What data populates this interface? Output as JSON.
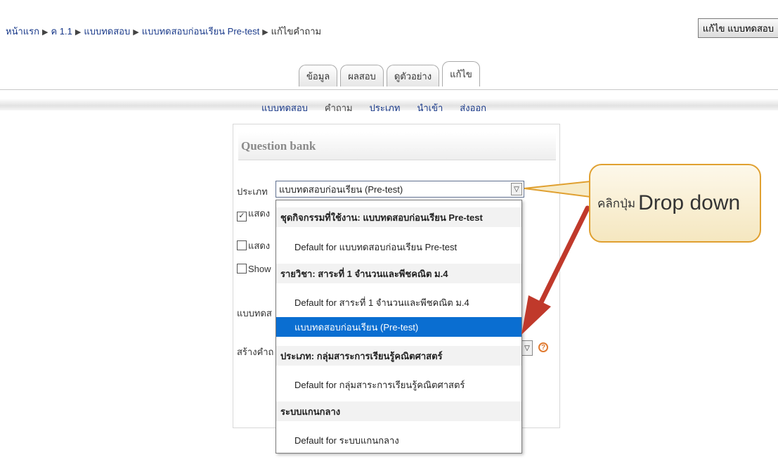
{
  "breadcrumb": {
    "items": [
      "หน้าแรก",
      "ค 1.1",
      "แบบทดสอบ",
      "แบบทดสอบก่อนเรียน Pre-test"
    ],
    "current": "แก้ไขคำถาม",
    "separator": "▶"
  },
  "header": {
    "edit_quiz_button": "แก้ไข แบบทดสอบ"
  },
  "tabs": [
    {
      "label": "ข้อมูล",
      "active": false
    },
    {
      "label": "ผลสอบ",
      "active": false
    },
    {
      "label": "ดูตัวอย่าง",
      "active": false
    },
    {
      "label": "แก้ไข",
      "active": true
    }
  ],
  "subtabs": [
    {
      "label": "แบบทดสอบ"
    },
    {
      "label": "คำถาม"
    },
    {
      "label": "ประเภท"
    },
    {
      "label": "นำเข้า"
    },
    {
      "label": "ส่งออก"
    }
  ],
  "question_bank": {
    "title": "Question bank",
    "category_label": "ประเภท",
    "category_value": "แบบทดสอบก่อนเรียน (Pre-test)",
    "checkbox_1": {
      "label": "แสดง",
      "checked": true
    },
    "checkbox_2": {
      "label": "แสดง",
      "checked": false
    },
    "checkbox_3": {
      "label": "Show",
      "checked": false
    },
    "partial_label_1": "แบบทดส",
    "partial_label_2": "สร้างคำถ"
  },
  "dropdown": {
    "rows": [
      {
        "type": "group",
        "label": "ชุดกิจกรรมที่ใช้งาน: แบบทดสอบก่อนเรียน  Pre-test"
      },
      {
        "type": "option",
        "label": "Default for แบบทดสอบก่อนเรียน Pre-test"
      },
      {
        "type": "group",
        "label": "รายวิชา: สาระที่ 1 จำนวนและพีชคณิต ม.4"
      },
      {
        "type": "option",
        "label": "Default for สาระที่ 1 จำนวนและพีชคณิต ม.4"
      },
      {
        "type": "option",
        "label": "แบบทดสอบก่อนเรียน (Pre-test)",
        "selected": true
      },
      {
        "type": "group",
        "label": "ประเภท: กลุ่มสาระการเรียนรู้คณิตศาสตร์"
      },
      {
        "type": "option",
        "label": "Default for กลุ่มสาระการเรียนรู้คณิตศาสตร์"
      },
      {
        "type": "group",
        "label": "ระบบแกนกลาง"
      },
      {
        "type": "option",
        "label": "Default for ระบบแกนกลาง"
      }
    ]
  },
  "callout": {
    "thai": "คลิกปุ่ม",
    "english": "Drop down"
  },
  "colors": {
    "link": "#1a3a8a",
    "selected_option": "#0a6ed1",
    "callout_border": "#e0a030",
    "arrow": "#c0392b",
    "help_icon": "#e07a30"
  },
  "icons": {
    "breadcrumb_separator": "triangle-right-icon",
    "select_arrow": "chevron-down-icon",
    "help": "help-icon"
  }
}
